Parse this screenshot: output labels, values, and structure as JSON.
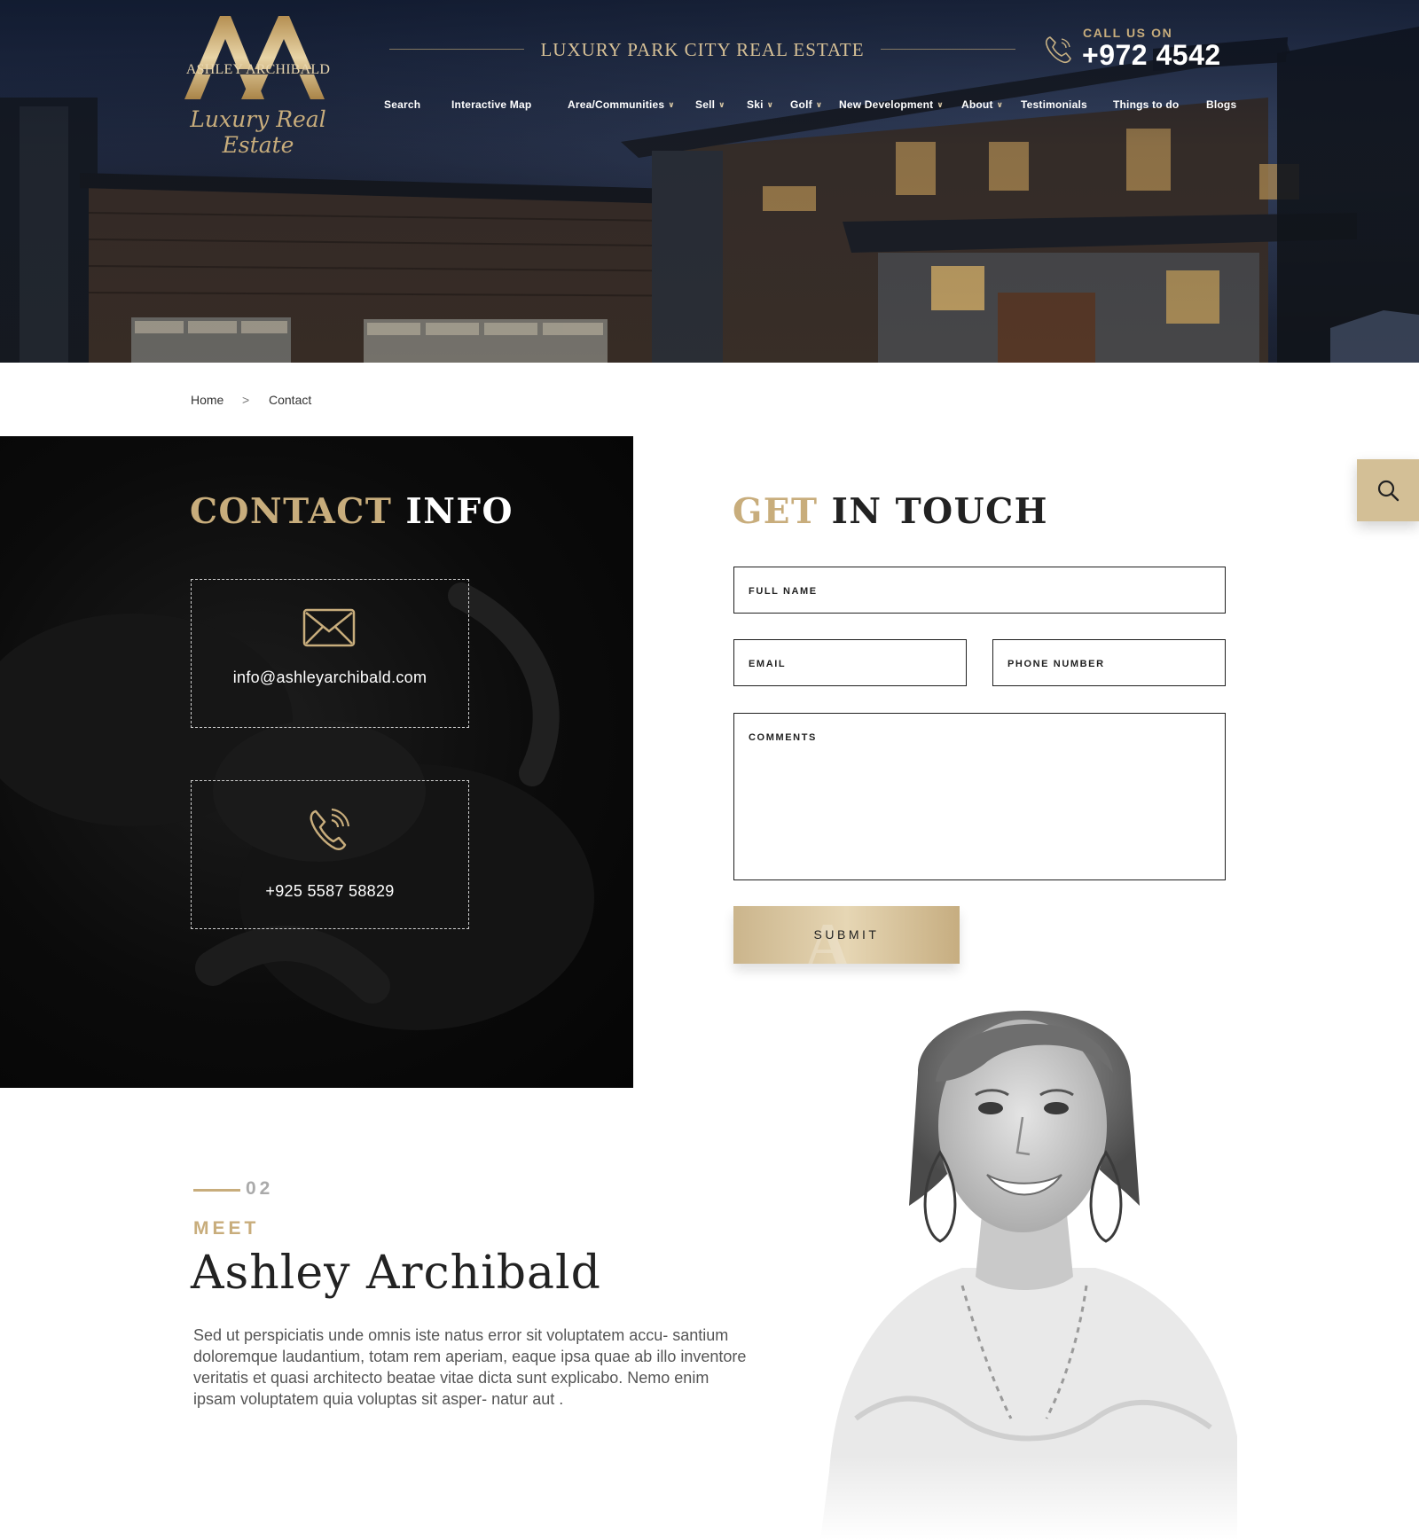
{
  "header": {
    "brand": "ASHLEY ARCHIBALD",
    "brand_script": "Luxury Real Estate",
    "tagline": "LUXURY PARK CITY REAL ESTATE",
    "call_label": "CALL US ON",
    "call_number": "+972 4542"
  },
  "nav": {
    "items": [
      {
        "label": "Search",
        "dropdown": false
      },
      {
        "label": "Interactive Map",
        "dropdown": false
      },
      {
        "label": "Area/Communities",
        "dropdown": true
      },
      {
        "label": "Sell",
        "dropdown": true
      },
      {
        "label": "Ski",
        "dropdown": true
      },
      {
        "label": "Golf",
        "dropdown": true
      },
      {
        "label": "New Development",
        "dropdown": true
      },
      {
        "label": "About",
        "dropdown": true
      },
      {
        "label": "Testimonials",
        "dropdown": false
      },
      {
        "label": "Things to do",
        "dropdown": false
      },
      {
        "label": "Blogs",
        "dropdown": false
      }
    ]
  },
  "breadcrumb": {
    "home": "Home",
    "separator": ">",
    "current": "Contact"
  },
  "contact_info": {
    "title_accent": "CONTACT",
    "title_rest": "INFO",
    "email": "info@ashleyarchibald.com",
    "phone": "+925 5587 58829"
  },
  "form": {
    "title_accent": "GET",
    "title_rest": "IN TOUCH",
    "full_name_placeholder": "FULL NAME",
    "email_placeholder": "EMAIL",
    "phone_placeholder": "PHONE NUMBER",
    "comments_placeholder": "COMMENTS",
    "submit_label": "SUBMIT"
  },
  "meet": {
    "number": "02",
    "label": "MEET",
    "name": "Ashley Archibald",
    "bio": "Sed ut perspiciatis unde omnis iste natus error sit voluptatem accu- santium doloremque laudantium, totam rem aperiam, eaque ipsa quae ab illo inventore veritatis et quasi architecto beatae vitae dicta sunt explicabo. Nemo enim ipsam voluptatem quia voluptas sit asper- natur aut ."
  },
  "icons": [
    "phone-icon",
    "chevron-down-icon",
    "envelope-icon",
    "phone-ringing-icon",
    "search-icon"
  ],
  "colors": {
    "gold": "#c8ad7c",
    "gold_light": "#e6d6b4",
    "dark": "#0b0b0b",
    "navy": "#1c2740",
    "text": "#222222"
  }
}
